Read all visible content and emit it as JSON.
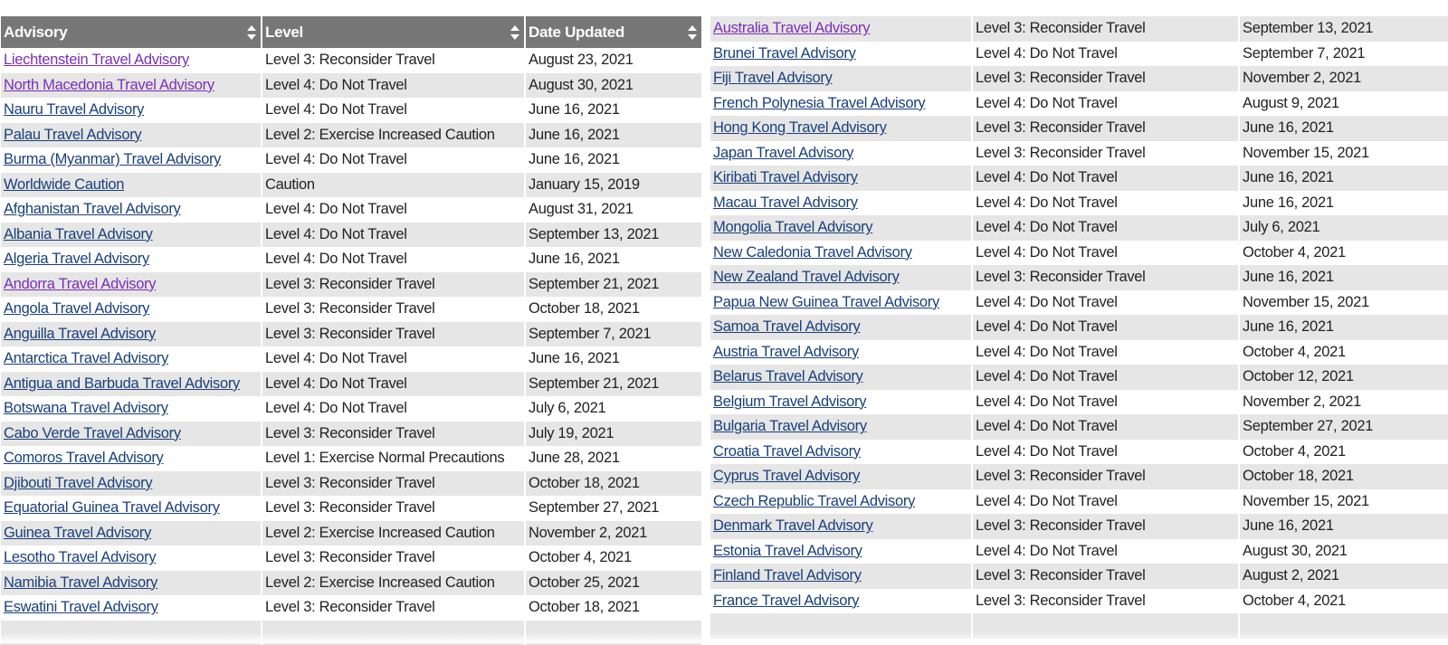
{
  "left_table": {
    "headers": [
      "Advisory",
      "Level",
      "Date Updated"
    ],
    "rows": [
      {
        "advisory": "Liechtenstein Travel Advisory",
        "level": "Level 3: Reconsider Travel",
        "date": "August 23, 2021",
        "visited": true
      },
      {
        "advisory": "North Macedonia Travel Advisory",
        "level": "Level 4: Do Not Travel",
        "date": "August 30, 2021",
        "visited": true
      },
      {
        "advisory": "Nauru Travel Advisory",
        "level": "Level 4: Do Not Travel",
        "date": "June 16, 2021",
        "visited": false
      },
      {
        "advisory": "Palau Travel Advisory",
        "level": "Level 2: Exercise Increased Caution",
        "date": "June 16, 2021",
        "visited": false
      },
      {
        "advisory": "Burma (Myanmar) Travel Advisory",
        "level": "Level 4: Do Not Travel",
        "date": "June 16, 2021",
        "visited": false
      },
      {
        "advisory": "Worldwide Caution",
        "level": "Caution",
        "date": "January 15, 2019",
        "visited": false
      },
      {
        "advisory": "Afghanistan Travel Advisory",
        "level": "Level 4: Do Not Travel",
        "date": "August 31, 2021",
        "visited": false
      },
      {
        "advisory": "Albania Travel Advisory",
        "level": "Level 4: Do Not Travel",
        "date": "September 13, 2021",
        "visited": false
      },
      {
        "advisory": "Algeria Travel Advisory",
        "level": "Level 4: Do Not Travel",
        "date": "June 16, 2021",
        "visited": false
      },
      {
        "advisory": "Andorra Travel Advisory",
        "level": "Level 3: Reconsider Travel",
        "date": "September 21, 2021",
        "visited": true
      },
      {
        "advisory": "Angola Travel Advisory",
        "level": "Level 3: Reconsider Travel",
        "date": "October 18, 2021",
        "visited": false
      },
      {
        "advisory": "Anguilla Travel Advisory",
        "level": "Level 3: Reconsider Travel",
        "date": "September 7, 2021",
        "visited": false
      },
      {
        "advisory": "Antarctica Travel Advisory",
        "level": "Level 4: Do Not Travel",
        "date": "June 16, 2021",
        "visited": false
      },
      {
        "advisory": "Antigua and Barbuda Travel Advisory",
        "level": "Level 4: Do Not Travel",
        "date": "September 21, 2021",
        "visited": false
      },
      {
        "advisory": "Botswana Travel Advisory",
        "level": "Level 4: Do Not Travel",
        "date": "July 6, 2021",
        "visited": false
      },
      {
        "advisory": "Cabo Verde Travel Advisory",
        "level": "Level 3: Reconsider Travel",
        "date": "July 19, 2021",
        "visited": false
      },
      {
        "advisory": "Comoros Travel Advisory",
        "level": "Level 1: Exercise Normal Precautions",
        "date": "June 28, 2021",
        "visited": false
      },
      {
        "advisory": "Djibouti Travel Advisory",
        "level": "Level 3: Reconsider Travel",
        "date": "October 18, 2021",
        "visited": false
      },
      {
        "advisory": "Equatorial Guinea Travel Advisory",
        "level": "Level 3: Reconsider Travel",
        "date": "September 27, 2021",
        "visited": false
      },
      {
        "advisory": "Guinea Travel Advisory",
        "level": "Level 2: Exercise Increased Caution",
        "date": "November 2, 2021",
        "visited": false
      },
      {
        "advisory": "Lesotho Travel Advisory",
        "level": "Level 3: Reconsider Travel",
        "date": "October 4, 2021",
        "visited": false
      },
      {
        "advisory": "Namibia Travel Advisory",
        "level": "Level 2: Exercise Increased Caution",
        "date": "October 25, 2021",
        "visited": false
      },
      {
        "advisory": "Eswatini Travel Advisory",
        "level": "Level 3: Reconsider Travel",
        "date": "October 18, 2021",
        "visited": false
      },
      {
        "advisory": "",
        "level": "",
        "date": "",
        "visited": false
      }
    ]
  },
  "right_table": {
    "rows": [
      {
        "advisory": "Australia Travel Advisory",
        "level": "Level 3: Reconsider Travel",
        "date": "September 13, 2021",
        "visited": true
      },
      {
        "advisory": "Brunei Travel Advisory",
        "level": "Level 4: Do Not Travel",
        "date": "September 7, 2021",
        "visited": false
      },
      {
        "advisory": "Fiji Travel Advisory",
        "level": "Level 3: Reconsider Travel",
        "date": "November 2, 2021",
        "visited": false
      },
      {
        "advisory": "French Polynesia Travel Advisory",
        "level": "Level 4: Do Not Travel",
        "date": "August 9, 2021",
        "visited": false
      },
      {
        "advisory": "Hong Kong Travel Advisory",
        "level": "Level 3: Reconsider Travel",
        "date": "June 16, 2021",
        "visited": false
      },
      {
        "advisory": "Japan Travel Advisory",
        "level": "Level 3: Reconsider Travel",
        "date": "November 15, 2021",
        "visited": false
      },
      {
        "advisory": "Kiribati Travel Advisory",
        "level": "Level 4: Do Not Travel",
        "date": "June 16, 2021",
        "visited": false
      },
      {
        "advisory": "Macau Travel Advisory",
        "level": "Level 4: Do Not Travel",
        "date": "June 16, 2021",
        "visited": false
      },
      {
        "advisory": "Mongolia Travel Advisory",
        "level": "Level 4: Do Not Travel",
        "date": "July 6, 2021",
        "visited": false
      },
      {
        "advisory": "New Caledonia Travel Advisory",
        "level": "Level 4: Do Not Travel",
        "date": "October 4, 2021",
        "visited": false
      },
      {
        "advisory": "New Zealand Travel Advisory",
        "level": "Level 3: Reconsider Travel",
        "date": "June 16, 2021",
        "visited": false
      },
      {
        "advisory": "Papua New Guinea Travel Advisory",
        "level": "Level 4: Do Not Travel",
        "date": "November 15, 2021",
        "visited": false
      },
      {
        "advisory": "Samoa Travel Advisory",
        "level": "Level 4: Do Not Travel",
        "date": "June 16, 2021",
        "visited": false
      },
      {
        "advisory": "Austria Travel Advisory",
        "level": "Level 4: Do Not Travel",
        "date": "October 4, 2021",
        "visited": false
      },
      {
        "advisory": "Belarus Travel Advisory",
        "level": "Level 4: Do Not Travel",
        "date": "October 12, 2021",
        "visited": false
      },
      {
        "advisory": "Belgium Travel Advisory",
        "level": "Level 4: Do Not Travel",
        "date": "November 2, 2021",
        "visited": false
      },
      {
        "advisory": "Bulgaria Travel Advisory",
        "level": "Level 4: Do Not Travel",
        "date": "September 27, 2021",
        "visited": false
      },
      {
        "advisory": "Croatia Travel Advisory",
        "level": "Level 4: Do Not Travel",
        "date": "October 4, 2021",
        "visited": false
      },
      {
        "advisory": "Cyprus Travel Advisory",
        "level": "Level 3: Reconsider Travel",
        "date": "October 18, 2021",
        "visited": false
      },
      {
        "advisory": "Czech Republic Travel Advisory",
        "level": "Level 4: Do Not Travel",
        "date": "November 15, 2021",
        "visited": false
      },
      {
        "advisory": "Denmark Travel Advisory",
        "level": "Level 3: Reconsider Travel",
        "date": "June 16, 2021",
        "visited": false
      },
      {
        "advisory": "Estonia Travel Advisory",
        "level": "Level 4: Do Not Travel",
        "date": "August 30, 2021",
        "visited": false
      },
      {
        "advisory": "Finland Travel Advisory",
        "level": "Level 3: Reconsider Travel",
        "date": "August 2, 2021",
        "visited": false
      },
      {
        "advisory": "France Travel Advisory",
        "level": "Level 3: Reconsider Travel",
        "date": "October 4, 2021",
        "visited": false
      },
      {
        "advisory": "",
        "level": "",
        "date": "",
        "visited": false
      }
    ]
  },
  "colors": {
    "header_bg": "#777777",
    "row_shade": "#e6e6e6",
    "link": "#1a3f7a",
    "link_visited": "#7b2fb5"
  }
}
